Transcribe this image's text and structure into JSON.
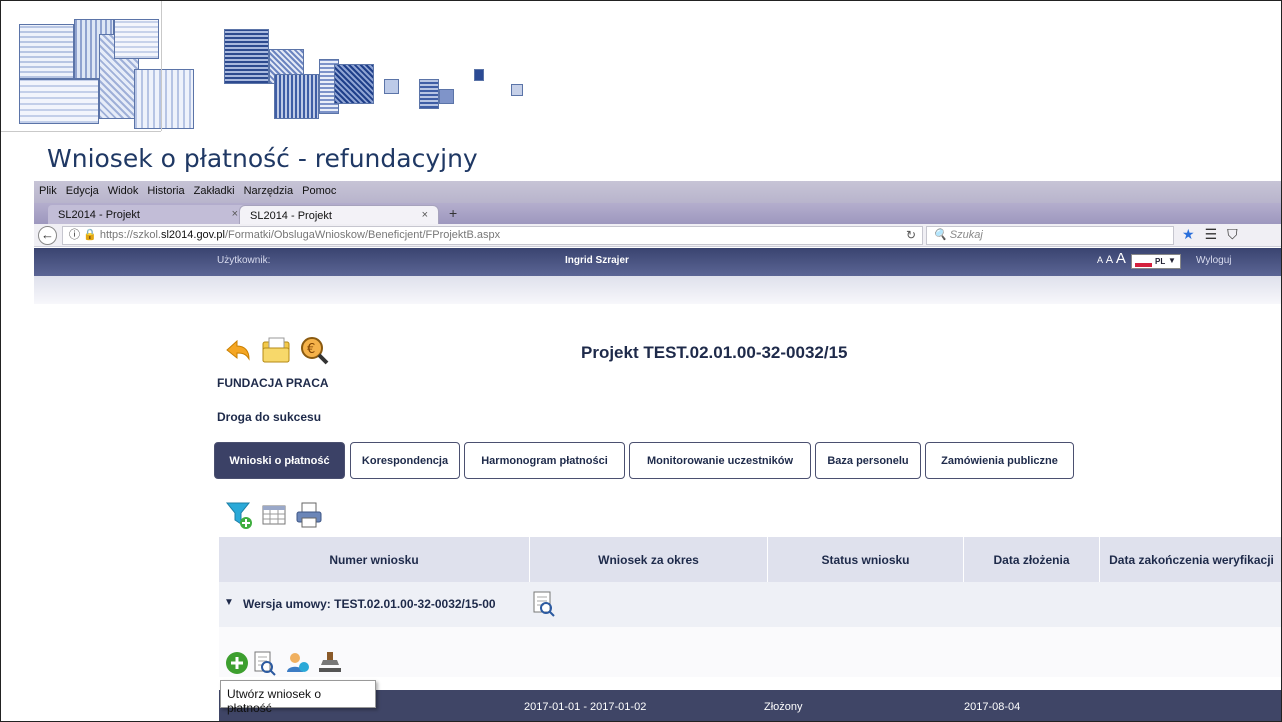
{
  "slide": {
    "title": "Wniosek o płatność - refundacyjny"
  },
  "browser": {
    "menu": [
      "Plik",
      "Edycja",
      "Widok",
      "Historia",
      "Zakładki",
      "Narzędzia",
      "Pomoc"
    ],
    "tabs": [
      {
        "label": "SL2014 - Projekt"
      },
      {
        "label": "SL2014 - Projekt"
      }
    ],
    "url_prefix": "https://szkol.",
    "url_domain": "sl2014.gov.pl",
    "url_path": "/Formatki/ObslugaWnioskow/Beneficjent/FProjektB.aspx",
    "search_placeholder": "Szukaj"
  },
  "app": {
    "user_label": "Użytkownik:",
    "user_name": "Ingrid Szrajer",
    "language": "PL",
    "logout": "Wyloguj",
    "project_title": "Projekt TEST.02.01.00-32-0032/15",
    "organization": "FUNDACJA PRACA",
    "project_name": "Droga do sukcesu",
    "nav_tabs": [
      "Wnioski o płatność",
      "Korespondencja",
      "Harmonogram płatności",
      "Monitorowanie uczestników",
      "Baza personelu",
      "Zamówienia publiczne"
    ],
    "grid": {
      "columns": [
        "Numer wniosku",
        "Wniosek za okres",
        "Status wniosku",
        "Data złożenia",
        "Data zakończenia weryfikacji"
      ],
      "group_label": "Wersja umowy: TEST.02.01.00-32-0032/15-00",
      "tooltip": "Utwórz wniosek o płatność",
      "row": {
        "period": "2017-01-01 - 2017-01-02",
        "status": "Złożony",
        "submitted": "2017-08-04"
      }
    }
  },
  "colors": {
    "header_dark": "#3b4166",
    "title_blue": "#1f3864",
    "accent_orange": "#f5a623"
  }
}
